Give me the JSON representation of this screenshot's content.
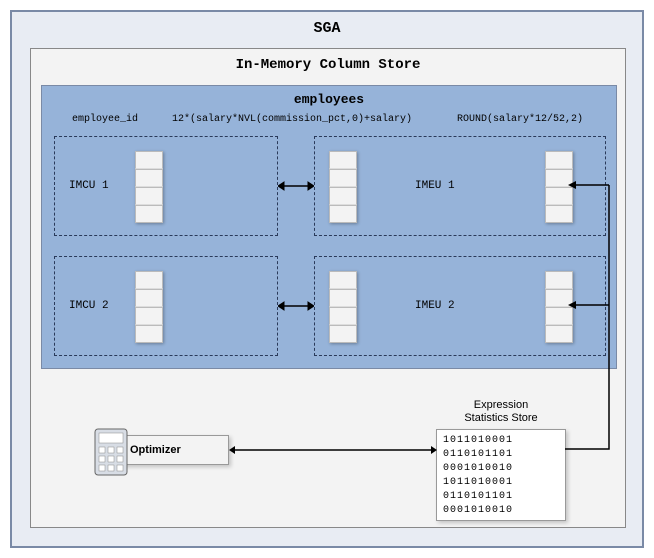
{
  "sga": {
    "title": "SGA"
  },
  "imcs": {
    "title": "In-Memory Column Store"
  },
  "employees": {
    "title": "employees",
    "columns": {
      "c1": "employee_id",
      "c2": "12*(salary*NVL(commission_pct,0)+salary)",
      "c3": "ROUND(salary*12/52,2)"
    }
  },
  "units": {
    "imcu1": "IMCU 1",
    "imcu2": "IMCU 2",
    "imeu1": "IMEU 1",
    "imeu2": "IMEU 2"
  },
  "ess": {
    "title_line1": "Expression",
    "title_line2": "Statistics Store",
    "data": {
      "r1": "1011010001",
      "r2": "0110101101",
      "r3": "0001010010",
      "r4": "1011010001",
      "r5": "0110101101",
      "r6": "0001010010"
    }
  },
  "optimizer": {
    "label": "Optimizer"
  }
}
